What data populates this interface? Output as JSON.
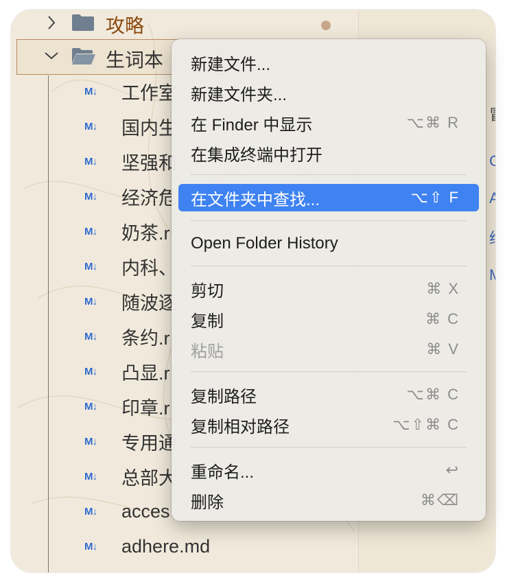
{
  "sidebar": {
    "folders": [
      {
        "label": "攻略",
        "expanded": false
      },
      {
        "label": "生词本",
        "expanded": true
      }
    ],
    "files": [
      {
        "icon": "M↓",
        "name": "工作室"
      },
      {
        "icon": "M↓",
        "name": "国内生"
      },
      {
        "icon": "M↓",
        "name": "坚强和"
      },
      {
        "icon": "M↓",
        "name": "经济危"
      },
      {
        "icon": "M↓",
        "name": "奶茶.r"
      },
      {
        "icon": "M↓",
        "name": "内科、"
      },
      {
        "icon": "M↓",
        "name": "随波逐"
      },
      {
        "icon": "M↓",
        "name": "条约.r"
      },
      {
        "icon": "M↓",
        "name": "凸显.r"
      },
      {
        "icon": "M↓",
        "name": "印章.r"
      },
      {
        "icon": "M↓",
        "name": "专用通"
      },
      {
        "icon": "M↓",
        "name": "总部大"
      },
      {
        "icon": "M↓",
        "name": "acces"
      },
      {
        "icon": "M↓",
        "name": "adhere.md"
      }
    ]
  },
  "right_peek": [
    "冒",
    "C",
    "A",
    "绉",
    "M"
  ],
  "context_menu": {
    "items": [
      {
        "label": "新建文件...",
        "shortcut": ""
      },
      {
        "label": "新建文件夹...",
        "shortcut": ""
      },
      {
        "label": "在 Finder 中显示",
        "shortcut": "⌥⌘ R"
      },
      {
        "label": "在集成终端中打开",
        "shortcut": ""
      },
      {
        "label": "在文件夹中查找...",
        "shortcut": "⌥⇧ F",
        "active": true
      },
      {
        "label": "Open Folder History",
        "shortcut": ""
      },
      {
        "label": "剪切",
        "shortcut": "⌘ X"
      },
      {
        "label": "复制",
        "shortcut": "⌘ C"
      },
      {
        "label": "粘贴",
        "shortcut": "⌘ V",
        "disabled": true
      },
      {
        "label": "复制路径",
        "shortcut": "⌥⌘ C"
      },
      {
        "label": "复制相对路径",
        "shortcut": "⌥⇧⌘ C"
      },
      {
        "label": "重命名...",
        "shortcut": "↩"
      },
      {
        "label": "删除",
        "shortcut": "⌘⌫"
      }
    ]
  },
  "colors": {
    "accent": "#3f82f1",
    "md_icon": "#2f6ad0",
    "folder_highlight": "#8a4a10"
  }
}
